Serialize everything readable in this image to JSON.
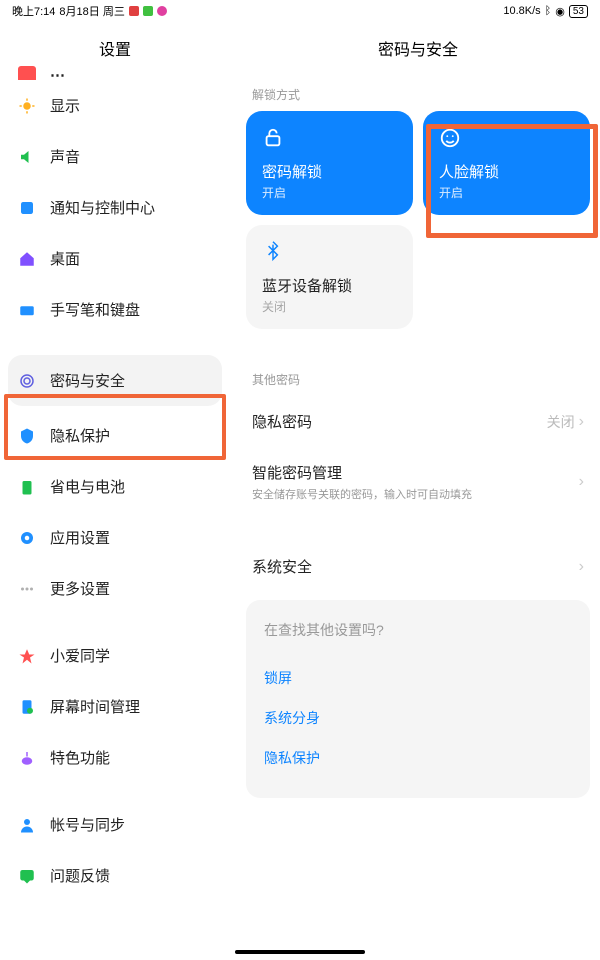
{
  "status": {
    "time": "晚上7:14",
    "date": "8月18日 周三",
    "net": "10.8K/s",
    "bat": "53"
  },
  "sidebar": {
    "title": "设置",
    "items": [
      {
        "label": "显示",
        "color": "#ffa500"
      },
      {
        "label": "声音",
        "color": "#20c030"
      },
      {
        "label": "通知与控制中心",
        "color": "#2090ff"
      },
      {
        "label": "桌面",
        "color": "#8050ff"
      },
      {
        "label": "手写笔和键盘",
        "color": "#2090ff"
      }
    ],
    "items2": [
      {
        "label": "密码与安全",
        "color": "#6060e0",
        "sel": true
      },
      {
        "label": "隐私保护",
        "color": "#2090ff"
      },
      {
        "label": "省电与电池",
        "color": "#20c030"
      },
      {
        "label": "应用设置",
        "color": "#2090ff"
      },
      {
        "label": "更多设置",
        "color": "#b0b0b0"
      }
    ],
    "items3": [
      {
        "label": "小爱同学",
        "color": "#ff5050"
      },
      {
        "label": "屏幕时间管理",
        "color": "#2090ff"
      },
      {
        "label": "特色功能",
        "color": "#a060ff"
      }
    ],
    "items4": [
      {
        "label": "帐号与同步",
        "color": "#2090ff"
      },
      {
        "label": "问题反馈",
        "color": "#20c030"
      }
    ]
  },
  "main": {
    "title": "密码与安全",
    "unlockLabel": "解锁方式",
    "cards": [
      {
        "title": "密码解锁",
        "sub": "开启"
      },
      {
        "title": "人脸解锁",
        "sub": "开启"
      },
      {
        "title": "蓝牙设备解锁",
        "sub": "关闭"
      }
    ],
    "otherLabel": "其他密码",
    "privacy": {
      "title": "隐私密码",
      "value": "关闭"
    },
    "smart": {
      "title": "智能密码管理",
      "sub": "安全储存账号关联的密码，输入时可自动填充"
    },
    "system": {
      "title": "系统安全"
    },
    "search": {
      "q": "在查找其他设置吗?",
      "links": [
        "锁屏",
        "系统分身",
        "隐私保护"
      ]
    }
  }
}
